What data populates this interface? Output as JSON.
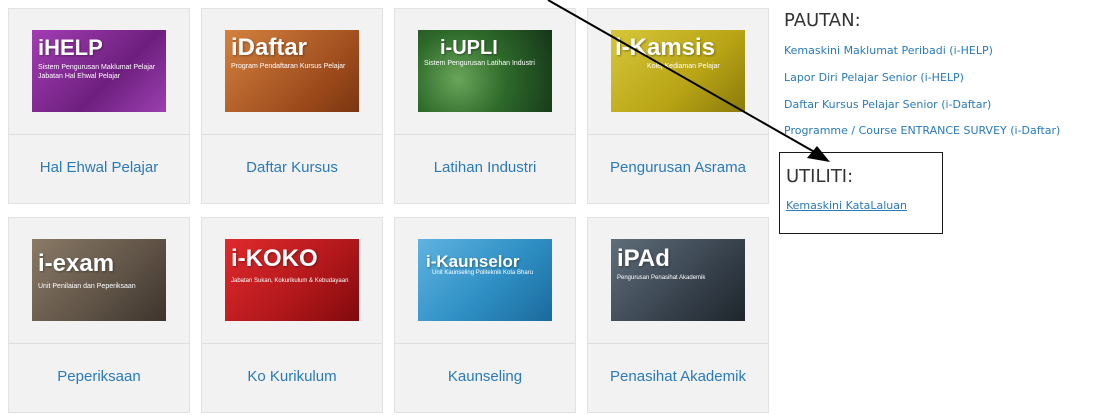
{
  "tiles": [
    {
      "label": "Hal Ehwal Pelajar",
      "logo_text": "iHELP",
      "logo_sub": "Sistem Pengurusan Maklumat Pelajar",
      "logo_sub2": "Jabatan Hal Ehwal Pelajar",
      "logo_bg": "#8b2d9a"
    },
    {
      "label": "Daftar Kursus",
      "logo_text": "iDaftar",
      "logo_sub": "Program Pendaftaran Kursus Pelajar",
      "logo_bg": "#b8632a"
    },
    {
      "label": "Latihan Industri",
      "logo_text": "i-UPLI",
      "logo_sub": "Sistem Pengurusan Latihan Industri",
      "logo_bg": "#2f6b2a"
    },
    {
      "label": "Pengurusan Asrama",
      "logo_text": "i-Kamsis",
      "logo_sub": "Kolej Kediaman Pelajar",
      "logo_bg": "#c8b81f"
    },
    {
      "label": "Peperiksaan",
      "logo_text": "i-exam",
      "logo_sub": "Unit Penilaian dan Peperiksaan",
      "logo_bg": "#5e5246"
    },
    {
      "label": "Ko Kurikulum",
      "logo_text": "i-KOKO",
      "logo_sub": "Jabatan Sukan, Kokurikulum & Kebudayaan",
      "logo_bg": "#c01b1e"
    },
    {
      "label": "Kaunseling",
      "logo_text": "i-Kaunselor",
      "logo_sub": "Unit Kaunseling Politeknik Kota Bharu",
      "logo_bg": "#2f8fc4"
    },
    {
      "label": "Penasihat Akademik",
      "logo_text": "iPAd",
      "logo_sub": "Pengurusan Penasihat Akademik",
      "logo_bg": "#3a4550"
    }
  ],
  "pautan": {
    "title": "PAUTAN:",
    "links": [
      "Kemaskini Maklumat Peribadi (i-HELP)",
      "Lapor Diri Pelajar Senior (i-HELP)",
      "Daftar Kursus Pelajar Senior (i-Daftar)",
      "Programme / Course ENTRANCE SURVEY (i-Daftar)"
    ]
  },
  "utiliti": {
    "title": "UTILITI:",
    "link": "Kemaskini KataLaluan"
  },
  "colors": {
    "link": "#2a7ab8",
    "tile_bg": "#f2f2f2",
    "arrow": "#000000"
  }
}
